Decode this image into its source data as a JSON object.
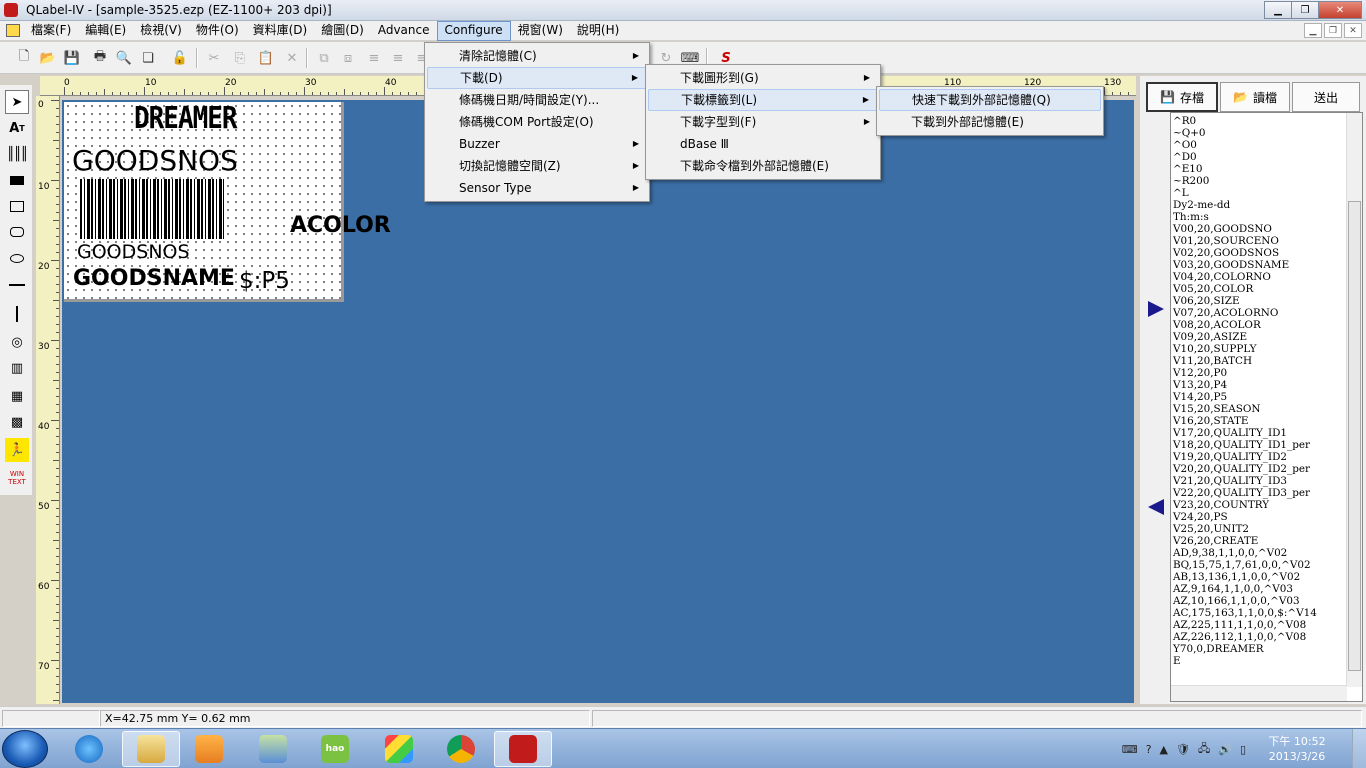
{
  "window": {
    "title": "QLabel-IV - [sample-3525.ezp   (EZ-1100+   203 dpi)]"
  },
  "menubar": {
    "items": [
      "檔案(F)",
      "編輯(E)",
      "檢視(V)",
      "物件(O)",
      "資料庫(D)",
      "繪圖(D)",
      "Advance",
      "Configure",
      "視窗(W)",
      "說明(H)"
    ]
  },
  "configure_menu": {
    "items": [
      "清除記憶體(C)",
      "下載(D)",
      "條碼機日期/時間設定(Y)...",
      "條碼機COM Port設定(O)",
      "Buzzer",
      "切換記憶體空間(Z)",
      "Sensor Type"
    ]
  },
  "download_menu": {
    "items": [
      "下載圖形到(G)",
      "下載標籤到(L)",
      "下載字型到(F)",
      "dBase Ⅲ",
      "下載命令檔到外部記憶體(E)"
    ]
  },
  "label_menu": {
    "items": [
      "快速下載到外部記憶體(Q)",
      "下載到外部記憶體(E)"
    ]
  },
  "ruler": {
    "unit": "mm",
    "top_ticks": [
      "0",
      "10",
      "20",
      "30",
      "40",
      "110",
      "120",
      "130"
    ],
    "left_ticks": [
      "0",
      "10",
      "20",
      "30",
      "40",
      "50",
      "60",
      "70"
    ]
  },
  "label": {
    "logo": "DREAMER",
    "goodsnos": "GOODSNOS",
    "acolor": "ACOLOR",
    "goodsnos2": "GOODSNOS",
    "goodsname": "GOODSNAME",
    "p5": "$:P5"
  },
  "right_panel": {
    "save_label": "存檔",
    "read_label": "讀檔",
    "send_label": "送出",
    "commands": [
      "^R0",
      "~Q+0",
      "^O0",
      "^D0",
      "^E10",
      "~R200",
      "^L",
      "Dy2-me-dd",
      "Th:m:s",
      "V00,20,GOODSNO",
      "V01,20,SOURCENO",
      "V02,20,GOODSNOS",
      "V03,20,GOODSNAME",
      "V04,20,COLORNO",
      "V05,20,COLOR",
      "V06,20,SIZE",
      "V07,20,ACOLORNO",
      "V08,20,ACOLOR",
      "V09,20,ASIZE",
      "V10,20,SUPPLY",
      "V11,20,BATCH",
      "V12,20,P0",
      "V13,20,P4",
      "V14,20,P5",
      "V15,20,SEASON",
      "V16,20,STATE",
      "V17,20,QUALITY_ID1",
      "V18,20,QUALITY_ID1_per",
      "V19,20,QUALITY_ID2",
      "V20,20,QUALITY_ID2_per",
      "V21,20,QUALITY_ID3",
      "V22,20,QUALITY_ID3_per",
      "V23,20,COUNTRY",
      "V24,20,PS",
      "V25,20,UNIT2",
      "V26,20,CREATE",
      "AD,9,38,1,1,0,0,^V02",
      "BQ,15,75,1,7,61,0,0,^V02",
      "AB,13,136,1,1,0,0,^V02",
      "AZ,9,164,1,1,0,0,^V03",
      "AZ,10,166,1,1,0,0,^V03",
      "AC,175,163,1,1,0,0,$:^V14",
      "AZ,225,111,1,1,0,0,^V08",
      "AZ,226,112,1,1,0,0,^V08",
      "Y70,0,DREAMER",
      "E"
    ]
  },
  "status": {
    "coords": "X=42.75 mm  Y= 0.62 mm"
  },
  "taskbar": {
    "clock_time": "下午 10:52",
    "clock_date": "2013/3/26",
    "hao_label": "hao"
  }
}
